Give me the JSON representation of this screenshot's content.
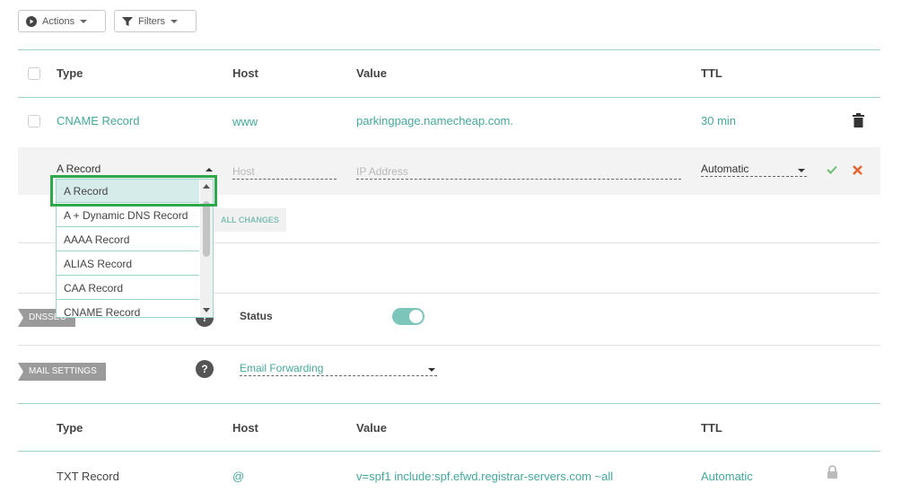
{
  "toolbar": {
    "actions_label": "Actions",
    "filters_label": "Filters"
  },
  "table_header": {
    "type": "Type",
    "host": "Host",
    "value": "Value",
    "ttl": "TTL"
  },
  "records": [
    {
      "type": "CNAME Record",
      "host": "www",
      "value": "parkingpage.namecheap.com.",
      "ttl": "30 min"
    }
  ],
  "edit_row": {
    "type_selected": "A Record",
    "host_placeholder": "Host",
    "value_placeholder": "IP Address",
    "ttl_selected": "Automatic"
  },
  "type_dropdown": {
    "options": [
      "A Record",
      "A + Dynamic DNS Record",
      "AAAA Record",
      "ALIAS Record",
      "CAA Record",
      "CNAME Record"
    ]
  },
  "save_all_label": "ALL CHANGES",
  "dnssec": {
    "tag": "DNSSEC",
    "status_label": "Status",
    "enabled": true
  },
  "mail_settings": {
    "tag": "MAIL SETTINGS",
    "selected": "Email Forwarding"
  },
  "mail_table_header": {
    "type": "Type",
    "host": "Host",
    "value": "Value",
    "ttl": "TTL"
  },
  "mail_records": [
    {
      "type": "TXT Record",
      "host": "@",
      "value": "v=spf1 include:spf.efwd.registrar-servers.com ~all",
      "ttl": "Automatic"
    }
  ],
  "colors": {
    "accent": "#45a89c",
    "delete": "#e8622c",
    "confirm": "#4caf50",
    "highlight": "#2ea84a"
  }
}
